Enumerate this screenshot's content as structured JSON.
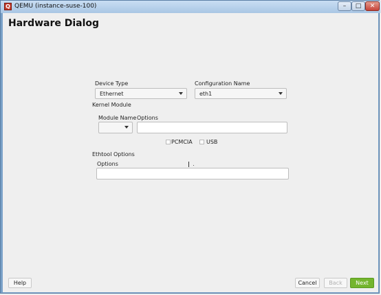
{
  "window": {
    "title": "QEMU (instance-suse-100)",
    "icon": "qemu-app-icon",
    "controls": {
      "minimize": "–",
      "maximize": "□",
      "close": "✕"
    }
  },
  "page": {
    "title": "Hardware Dialog"
  },
  "form": {
    "device_type": {
      "label": "Device Type",
      "value": "Ethernet"
    },
    "configuration_name": {
      "label": "Configuration Name",
      "value": "eth1"
    },
    "kernel_module": {
      "section_label": "Kernel Module",
      "module_name": {
        "label": "Module Name",
        "value": ""
      },
      "options": {
        "label": "Options",
        "value": ""
      },
      "pcmcia": {
        "label": "PCMCIA",
        "checked": false
      },
      "usb": {
        "label": "USB",
        "checked": false
      }
    },
    "ethtool": {
      "section_label": "Ethtool Options",
      "options": {
        "label": "Options",
        "value": ""
      }
    }
  },
  "buttons": {
    "help": "Help",
    "cancel": "Cancel",
    "back": "Back",
    "next": "Next"
  },
  "colors": {
    "accent_green": "#74b52e",
    "titlebar": "#b9d3ee"
  }
}
